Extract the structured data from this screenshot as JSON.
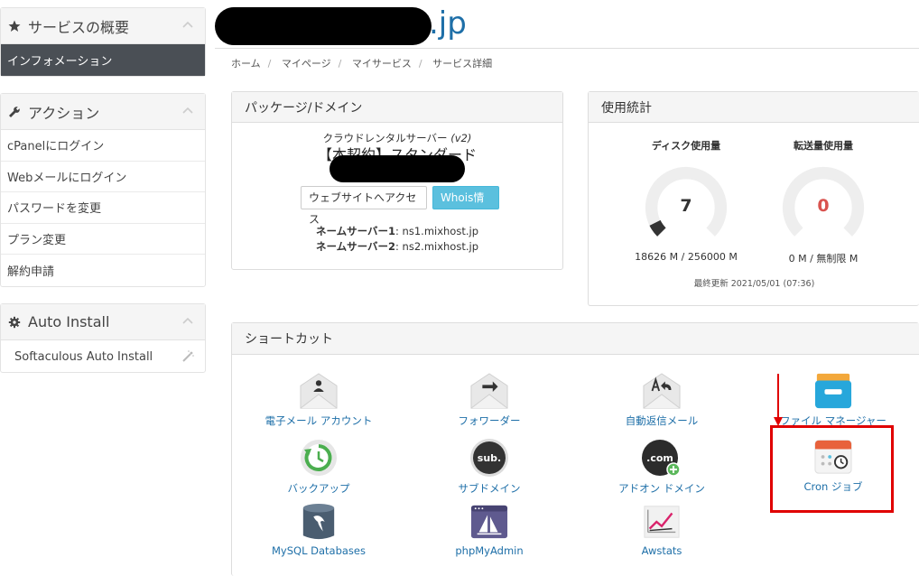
{
  "sidebar": {
    "overview": {
      "title": "サービスの概要",
      "items": [
        {
          "label": "インフォメーション"
        }
      ]
    },
    "actions": {
      "title": "アクション",
      "items": [
        {
          "label": "cPanelにログイン"
        },
        {
          "label": "Webメールにログイン"
        },
        {
          "label": "パスワードを変更"
        },
        {
          "label": "プラン変更"
        },
        {
          "label": "解約申請"
        }
      ]
    },
    "autoinstall": {
      "title": "Auto Install",
      "items": [
        {
          "label": "Softaculous Auto Install"
        }
      ]
    }
  },
  "header": {
    "domain_suffix": ".jp"
  },
  "breadcrumb": [
    "ホーム",
    "マイページ",
    "マイサービス",
    "サービス詳細"
  ],
  "package": {
    "title": "パッケージ/ドメイン",
    "product": "クラウドレンタルサーバー",
    "version": "(v2)",
    "plan": "【本契約】スタンダード",
    "visit_button": "ウェブサイトへアクセス",
    "whois_button": "Whois情報",
    "ns1_label": "ネームサーバー1",
    "ns1_value": ": ns1.mixhost.jp",
    "ns2_label": "ネームサーバー2",
    "ns2_value": ": ns2.mixhost.jp"
  },
  "usage": {
    "title": "使用統計",
    "disk": {
      "label": "ディスク使用量",
      "value": "7",
      "detail": "18626 M / 256000 M",
      "fraction": 0.07
    },
    "bandwidth": {
      "label": "転送量使用量",
      "value": "0",
      "detail": "0 M / 無制限 M",
      "fraction": 0
    },
    "updated": "最終更新 2021/05/01 (07:36)"
  },
  "shortcuts": {
    "title": "ショートカット",
    "items": [
      {
        "label": "電子メール アカウント",
        "icon": "email-account-icon"
      },
      {
        "label": "フォワーダー",
        "icon": "forwarder-icon"
      },
      {
        "label": "自動返信メール",
        "icon": "autoresponder-icon"
      },
      {
        "label": "ファイル マネージャー",
        "icon": "file-manager-icon"
      },
      {
        "label": "バックアップ",
        "icon": "backup-icon"
      },
      {
        "label": "サブドメイン",
        "icon": "subdomain-icon"
      },
      {
        "label": "アドオン ドメイン",
        "icon": "addon-domain-icon"
      },
      {
        "label": "Cron ジョブ",
        "icon": "cron-job-icon"
      },
      {
        "label": "MySQL Databases",
        "icon": "mysql-icon"
      },
      {
        "label": "phpMyAdmin",
        "icon": "phpmyadmin-icon"
      },
      {
        "label": "Awstats",
        "icon": "awstats-icon"
      }
    ],
    "subdomain_badge": "sub.",
    "addon_badge": ".com"
  },
  "colors": {
    "link": "#1e6fa8",
    "highlight": "#e00000",
    "active_nav": "#4a4f55",
    "info_button": "#5bc0de"
  }
}
